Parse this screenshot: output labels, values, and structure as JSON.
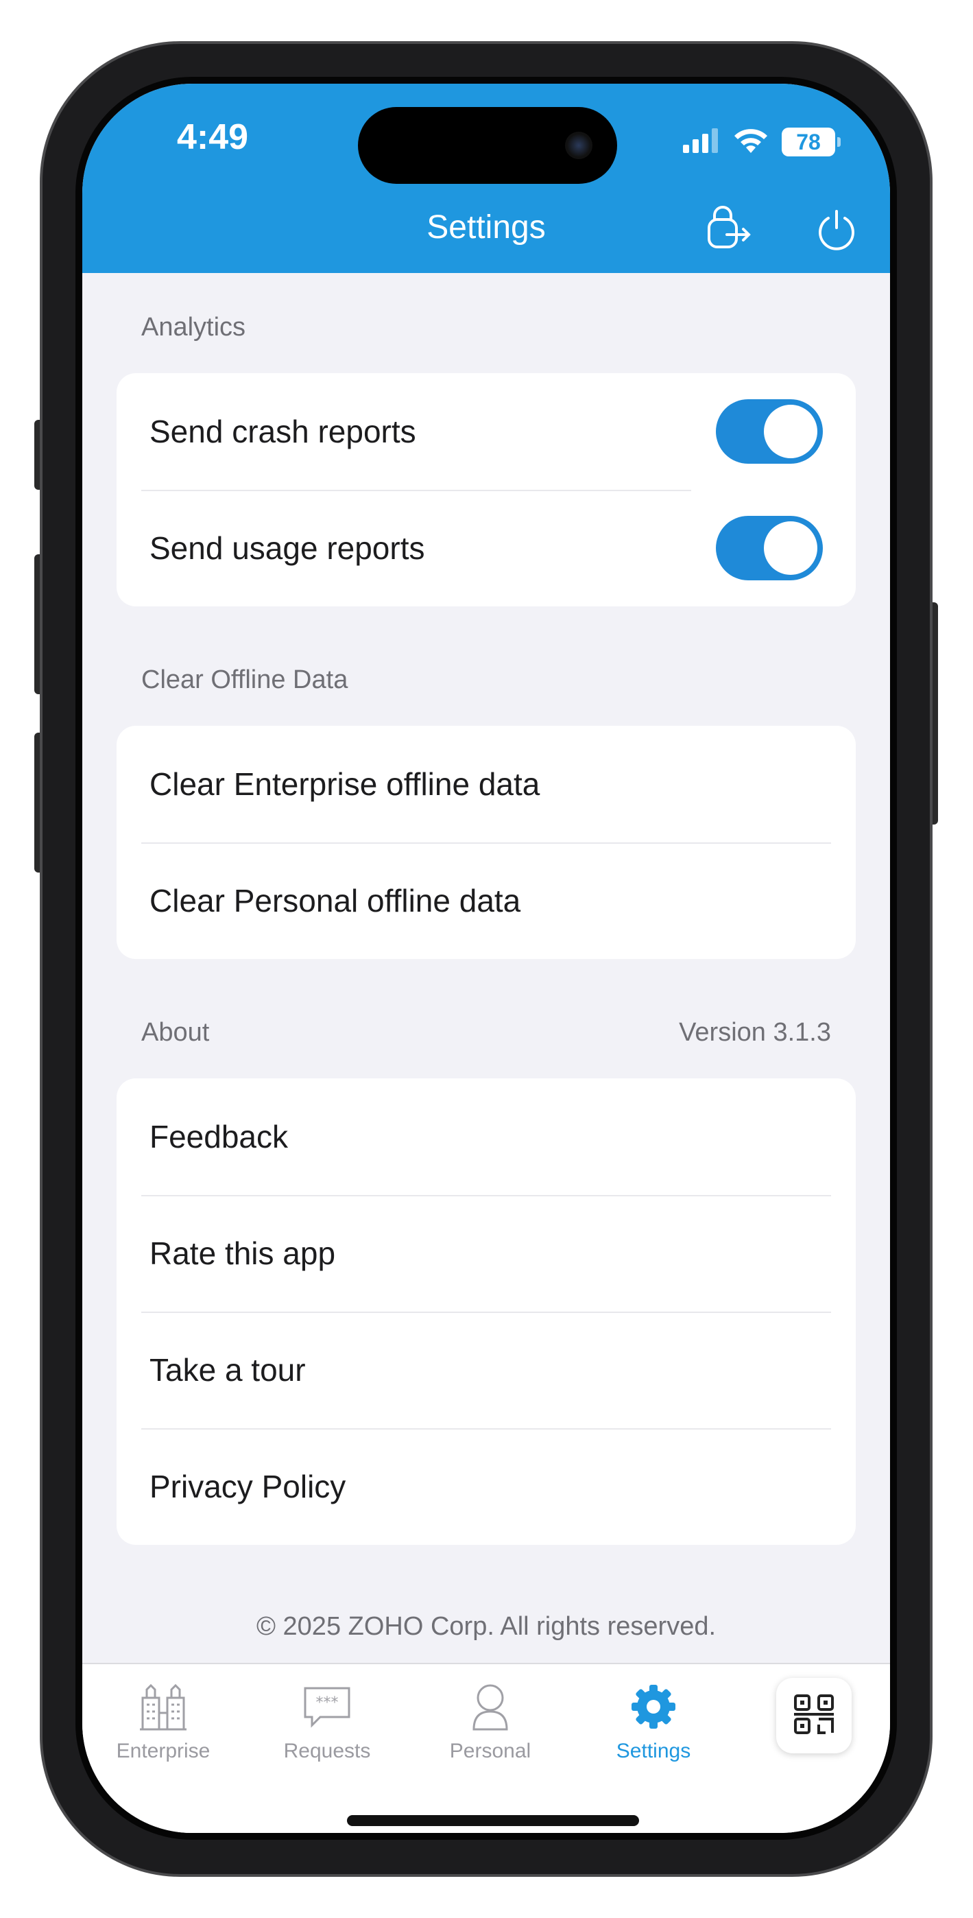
{
  "status_bar": {
    "time": "4:49",
    "battery": "78"
  },
  "header": {
    "title": "Settings",
    "icons": [
      "logout-icon",
      "power-icon"
    ]
  },
  "sections": {
    "analytics": {
      "title": "Analytics",
      "items": [
        {
          "label": "Send crash reports",
          "enabled": true
        },
        {
          "label": "Send usage reports",
          "enabled": true
        }
      ]
    },
    "offline": {
      "title": "Clear Offline Data",
      "items": [
        {
          "label": "Clear Enterprise offline data"
        },
        {
          "label": "Clear Personal offline data"
        }
      ]
    },
    "about": {
      "title": "About",
      "version": "Version 3.1.3",
      "items": [
        {
          "label": "Feedback"
        },
        {
          "label": "Rate this app"
        },
        {
          "label": "Take a tour"
        },
        {
          "label": "Privacy Policy"
        }
      ]
    }
  },
  "footer": {
    "copyright": "© 2025 ZOHO Corp. All rights reserved."
  },
  "tabbar": {
    "tabs": [
      {
        "label": "Enterprise",
        "icon": "buildings-icon"
      },
      {
        "label": "Requests",
        "icon": "chat-icon"
      },
      {
        "label": "Personal",
        "icon": "person-icon"
      },
      {
        "label": "Settings",
        "icon": "gear-icon",
        "active": true
      }
    ],
    "qr_icon": "qr-scan-icon"
  },
  "colors": {
    "accent": "#1f97df",
    "toggle_on": "#1f8ad8",
    "background": "#f2f2f7"
  }
}
